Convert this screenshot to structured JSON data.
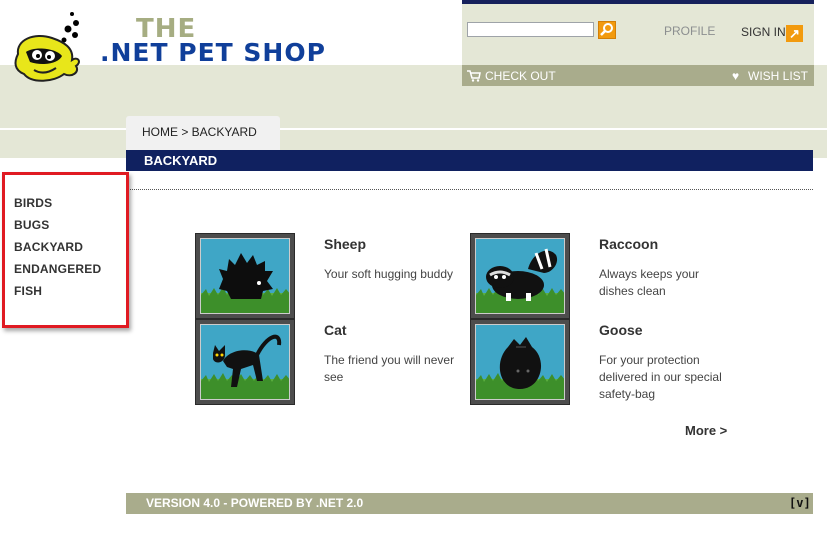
{
  "brand": {
    "line1": "THE",
    "line2": ".NET PET SHOP"
  },
  "header": {
    "search": {
      "value": "",
      "placeholder": ""
    },
    "profile_label": "PROFILE",
    "signin_label": "SIGN IN",
    "checkout_label": "CHECK OUT",
    "wishlist_label": "WISH LIST"
  },
  "breadcrumb": "HOME > BACKYARD",
  "section_title": "BACKYARD",
  "categories": [
    "BIRDS",
    "BUGS",
    "BACKYARD",
    "ENDANGERED",
    "FISH"
  ],
  "products": [
    {
      "name": "Sheep",
      "description": "Your soft hugging buddy",
      "icon": "sheep-image"
    },
    {
      "name": "Raccoon",
      "description": "Always keeps your dishes clean",
      "icon": "raccoon-image"
    },
    {
      "name": "Cat",
      "description": "The friend you will never see",
      "icon": "cat-image"
    },
    {
      "name": "Goose",
      "description": "For your protection delivered in our special safety-bag",
      "icon": "goose-image"
    }
  ],
  "more_label": "More >",
  "footer": {
    "text": "VERSION 4.0 - POWERED BY .NET 2.0",
    "icon_label": "[v]"
  },
  "colors": {
    "accent": "#f29a0e",
    "navy": "#102160",
    "olive": "#a9ac8c",
    "highlight_border": "#e01a22"
  }
}
